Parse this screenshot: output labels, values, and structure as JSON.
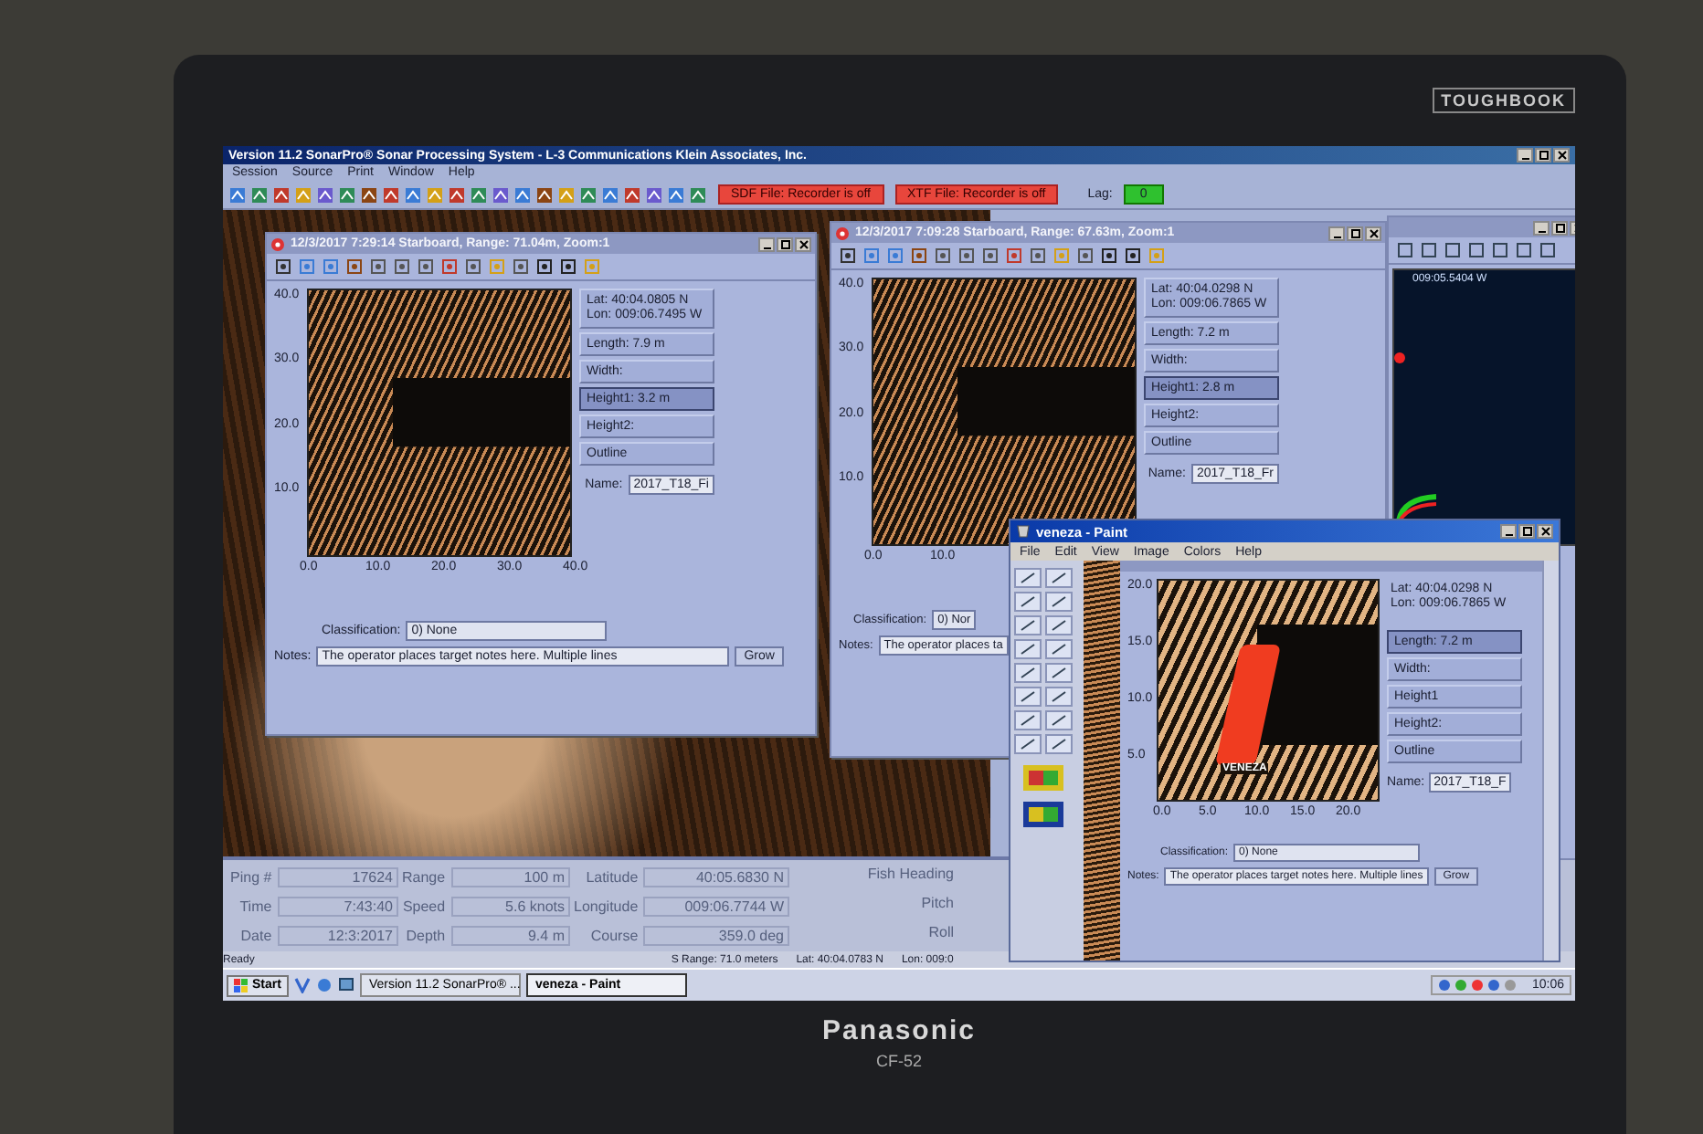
{
  "bezel": {
    "badge": "TOUGHBOOK",
    "brand": "Panasonic",
    "model": "CF-52"
  },
  "app": {
    "title": "Version 11.2 SonarPro® Sonar Processing System - L-3 Communications Klein Associates, Inc.",
    "menu": [
      "Session",
      "Source",
      "Print",
      "Window",
      "Help"
    ],
    "recorders": [
      "SDF File: Recorder is off",
      "XTF File: Recorder is off"
    ],
    "lag_label": "Lag:",
    "lag_value": "0"
  },
  "target_windows": [
    {
      "title": "12/3/2017 7:29:14 Starboard, Range: 71.04m, Zoom:1",
      "lat": "Lat:   40:04.0805 N",
      "lon": "Lon: 009:06.7495 W",
      "fields": [
        {
          "label": "Length:  7.9 m",
          "selected": false
        },
        {
          "label": "Width:",
          "selected": false
        },
        {
          "label": "Height1:  3.2 m",
          "selected": true
        },
        {
          "label": "Height2:",
          "selected": false
        },
        {
          "label": "Outline",
          "selected": false
        }
      ],
      "name_label": "Name:",
      "name_value": "2017_T18_Fi",
      "yticks": [
        "40.0",
        "30.0",
        "20.0",
        "10.0"
      ],
      "xticks": [
        "0.0",
        "10.0",
        "20.0",
        "30.0",
        "40.0"
      ],
      "classification_label": "Classification:",
      "classification": "0) None",
      "notes_label": "Notes:",
      "notes": "The operator places target notes here. Multiple lines",
      "grow": "Grow"
    },
    {
      "title": "12/3/2017 7:09:28 Starboard, Range: 67.63m, Zoom:1",
      "lat": "Lat:   40:04.0298 N",
      "lon": "Lon: 009:06.7865 W",
      "fields": [
        {
          "label": "Length:  7.2 m",
          "selected": false
        },
        {
          "label": "Width:",
          "selected": false
        },
        {
          "label": "Height1:  2.8 m",
          "selected": true
        },
        {
          "label": "Height2:",
          "selected": false
        },
        {
          "label": "Outline",
          "selected": false
        }
      ],
      "name_label": "Name:",
      "name_value": "2017_T18_Fr",
      "yticks": [
        "40.0",
        "30.0",
        "20.0",
        "10.0"
      ],
      "xticks": [
        "0.0",
        "10.0"
      ],
      "classification_label": "Classification:",
      "classification": "0) Nor",
      "notes_label": "Notes:",
      "notes": "The operator places ta"
    }
  ],
  "nav_window": {
    "reading": "009:05.5404 W"
  },
  "paint_window": {
    "title": "veneza - Paint",
    "menu": [
      "File",
      "Edit",
      "View",
      "Image",
      "Colors",
      "Help"
    ],
    "image": {
      "lat": "Lat:   40:04.0298 N",
      "lon": "Lon: 009:06.7865 W",
      "fields": [
        {
          "label": "Length:  7.2 m",
          "selected": true
        },
        {
          "label": "Width:",
          "selected": false
        },
        {
          "label": "Height1",
          "selected": false
        },
        {
          "label": "Height2:",
          "selected": false
        },
        {
          "label": "Outline",
          "selected": false
        }
      ],
      "name_label": "Name:",
      "name_value": "2017_T18_F",
      "yticks": [
        "20.0",
        "15.0",
        "10.0",
        "5.0"
      ],
      "xticks": [
        "0.0",
        "5.0",
        "10.0",
        "15.0",
        "20.0"
      ],
      "annotation": "VENEZA",
      "classification_label": "Classification:",
      "classification": "0) None",
      "notes_label": "Notes:",
      "notes": "The operator places target notes here. Multiple lines",
      "grow": "Grow"
    }
  },
  "data_columns": [
    [
      {
        "label": "Ping #",
        "value": "17624"
      },
      {
        "label": "Time",
        "value": "7:43:40"
      },
      {
        "label": "Date",
        "value": "12:3:2017"
      }
    ],
    [
      {
        "label": "Range",
        "value": "100 m"
      },
      {
        "label": "Speed",
        "value": "5.6 knots"
      },
      {
        "label": "Depth",
        "value": "9.4 m"
      }
    ],
    [
      {
        "label": "Latitude",
        "value": "40:05.6830 N"
      },
      {
        "label": "Longitude",
        "value": "009:06.7744 W"
      },
      {
        "label": "Course",
        "value": "359.0 deg"
      }
    ],
    [
      {
        "label": "Fish Heading"
      },
      {
        "label": "Pitch"
      },
      {
        "label": "Roll"
      }
    ]
  ],
  "status_bar": [
    "Ready",
    "S Range: 71.0 meters",
    "Lat: 40:04.0783 N",
    "Lon: 009:0"
  ],
  "taskbar": {
    "start": "Start",
    "tasks": [
      {
        "label": "Version 11.2 SonarPro® ...",
        "selected": false
      },
      {
        "label": "veneza - Paint",
        "selected": true
      }
    ],
    "clock": "10:06"
  }
}
